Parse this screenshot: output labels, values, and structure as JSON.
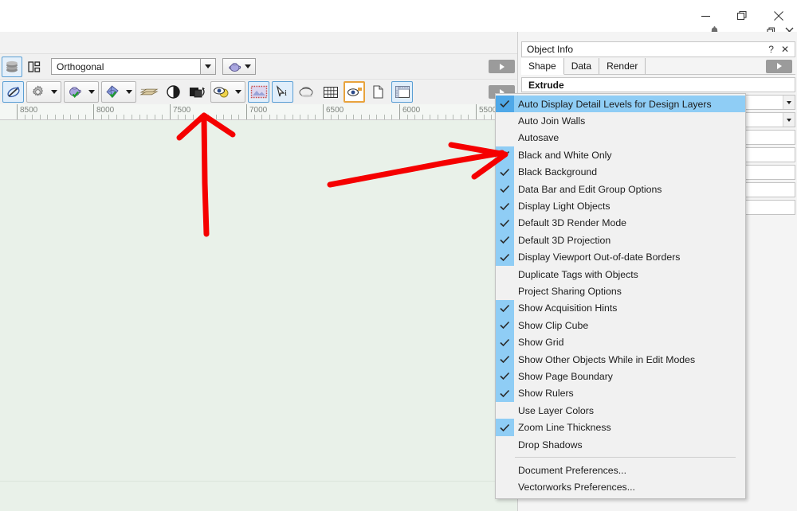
{
  "window": {
    "os_controls": [
      {
        "name": "minimize",
        "glyph": "minimize-icon"
      },
      {
        "name": "restore",
        "glyph": "restore-icon"
      },
      {
        "name": "close",
        "glyph": "close-icon"
      }
    ],
    "app_controls": [
      {
        "name": "app-minimize",
        "glyph": "minimize-icon"
      },
      {
        "name": "app-restore",
        "glyph": "restore-icon"
      },
      {
        "name": "app-close",
        "glyph": "close-icon"
      }
    ],
    "notification_icon": "bell-icon"
  },
  "viewbar": {
    "stack_icon": "layer-stack-icon",
    "panel_icon": "panel-layout-icon",
    "projection": {
      "value": "Orthogonal",
      "placeholder": "Orthogonal"
    },
    "render_icon": "render-teapot-icon",
    "overflow_label": ""
  },
  "toolbar": {
    "buttons": [
      {
        "name": "tb-flyover",
        "icon": "flyover-tool-icon",
        "state": "selected"
      },
      {
        "name": "tb-gear",
        "icon": "gear-icon",
        "state": "dropdown"
      },
      {
        "name": "tb-render-teapot",
        "icon": "render-teapot-check-icon",
        "state": "dropdown"
      },
      {
        "name": "tb-globe",
        "icon": "globe-check-icon",
        "state": "dropdown"
      },
      {
        "name": "tb-layers",
        "icon": "layer-edge-icon",
        "state": "normal"
      },
      {
        "name": "tb-contrast",
        "icon": "contrast-circle-icon",
        "state": "normal"
      },
      {
        "name": "tb-blacks",
        "icon": "black-white-only-icon",
        "state": "normal"
      },
      {
        "name": "tb-eye-yellow",
        "icon": "eye-visibility-icon",
        "state": "dropdown"
      },
      {
        "name": "tb-page-boundary",
        "icon": "page-boundary-icon",
        "state": "selected"
      },
      {
        "name": "tb-data-bar",
        "icon": "data-bar-icon",
        "state": "selected"
      },
      {
        "name": "tb-drop-shadow",
        "icon": "drop-shadow-icon",
        "state": "normal"
      },
      {
        "name": "tb-grid",
        "icon": "show-grid-icon",
        "state": "normal"
      },
      {
        "name": "tb-clip-cube",
        "icon": "clip-cube-eye-icon",
        "state": "selected-orange"
      },
      {
        "name": "tb-page",
        "icon": "page-icon",
        "state": "normal"
      },
      {
        "name": "tb-rulers",
        "icon": "show-rulers-icon",
        "state": "selected"
      }
    ]
  },
  "ruler": {
    "labels": [
      "8500",
      "8000",
      "7500",
      "7000",
      "6500",
      "6000",
      "5500"
    ],
    "unit_spacing_px": 96
  },
  "object_info": {
    "title": "Object Info",
    "help_glyph": "?",
    "close_glyph": "✕",
    "tabs": [
      {
        "label": "Shape",
        "active": true
      },
      {
        "label": "Data",
        "active": false
      },
      {
        "label": "Render",
        "active": false
      }
    ],
    "object_type": "Extrude",
    "fields": [
      {
        "type": "dropdown",
        "value": ""
      },
      {
        "type": "dropdown",
        "value": ""
      },
      {
        "type": "text",
        "value": ""
      },
      {
        "type": "text",
        "value": ""
      },
      {
        "type": "text",
        "value": ""
      },
      {
        "type": "text",
        "value": ""
      },
      {
        "type": "text",
        "value": ""
      }
    ]
  },
  "menu": {
    "items": [
      {
        "label": "Auto Display Detail Levels for Design Layers",
        "checked": true,
        "highlighted": true
      },
      {
        "label": "Auto Join Walls",
        "checked": false,
        "highlighted": false
      },
      {
        "label": "Autosave",
        "checked": false,
        "highlighted": false
      },
      {
        "label": "Black and White Only",
        "checked": true,
        "highlighted": false
      },
      {
        "label": "Black Background",
        "checked": true,
        "highlighted": false
      },
      {
        "label": "Data Bar and Edit Group Options",
        "checked": true,
        "highlighted": false
      },
      {
        "label": "Display Light Objects",
        "checked": true,
        "highlighted": false
      },
      {
        "label": "Default 3D Render Mode",
        "checked": true,
        "highlighted": false
      },
      {
        "label": "Default 3D Projection",
        "checked": true,
        "highlighted": false
      },
      {
        "label": "Display Viewport Out-of-date Borders",
        "checked": true,
        "highlighted": false
      },
      {
        "label": "Duplicate Tags with Objects",
        "checked": false,
        "highlighted": false
      },
      {
        "label": "Project Sharing Options",
        "checked": false,
        "highlighted": false
      },
      {
        "label": "Show Acquisition Hints",
        "checked": true,
        "highlighted": false
      },
      {
        "label": "Show Clip Cube",
        "checked": true,
        "highlighted": false
      },
      {
        "label": "Show Grid",
        "checked": true,
        "highlighted": false
      },
      {
        "label": "Show Other Objects While in Edit Modes",
        "checked": true,
        "highlighted": false
      },
      {
        "label": "Show Page Boundary",
        "checked": true,
        "highlighted": false
      },
      {
        "label": "Show Rulers",
        "checked": true,
        "highlighted": false
      },
      {
        "label": "Use Layer Colors",
        "checked": false,
        "highlighted": false
      },
      {
        "label": "Zoom Line Thickness",
        "checked": true,
        "highlighted": false
      },
      {
        "label": "Drop Shadows",
        "checked": false,
        "highlighted": false
      },
      {
        "separator": true
      },
      {
        "label": "Document Preferences...",
        "checked": false,
        "highlighted": false
      },
      {
        "label": "Vectorworks Preferences...",
        "checked": false,
        "highlighted": false
      }
    ]
  },
  "annotations": {
    "color": "#f50000",
    "arrows": [
      {
        "name": "arrow-up-to-contrast-tool",
        "direction": "up"
      },
      {
        "name": "arrow-right-to-checkmark-column",
        "direction": "right"
      }
    ]
  },
  "colors": {
    "canvas": "#e9f1e9",
    "menu_bg": "#f1f1f1",
    "menu_highlight": "#8fcdf5",
    "check_column": "#8fcdf5",
    "accent_orange": "#e8a33d",
    "annotation_red": "#f50000"
  }
}
